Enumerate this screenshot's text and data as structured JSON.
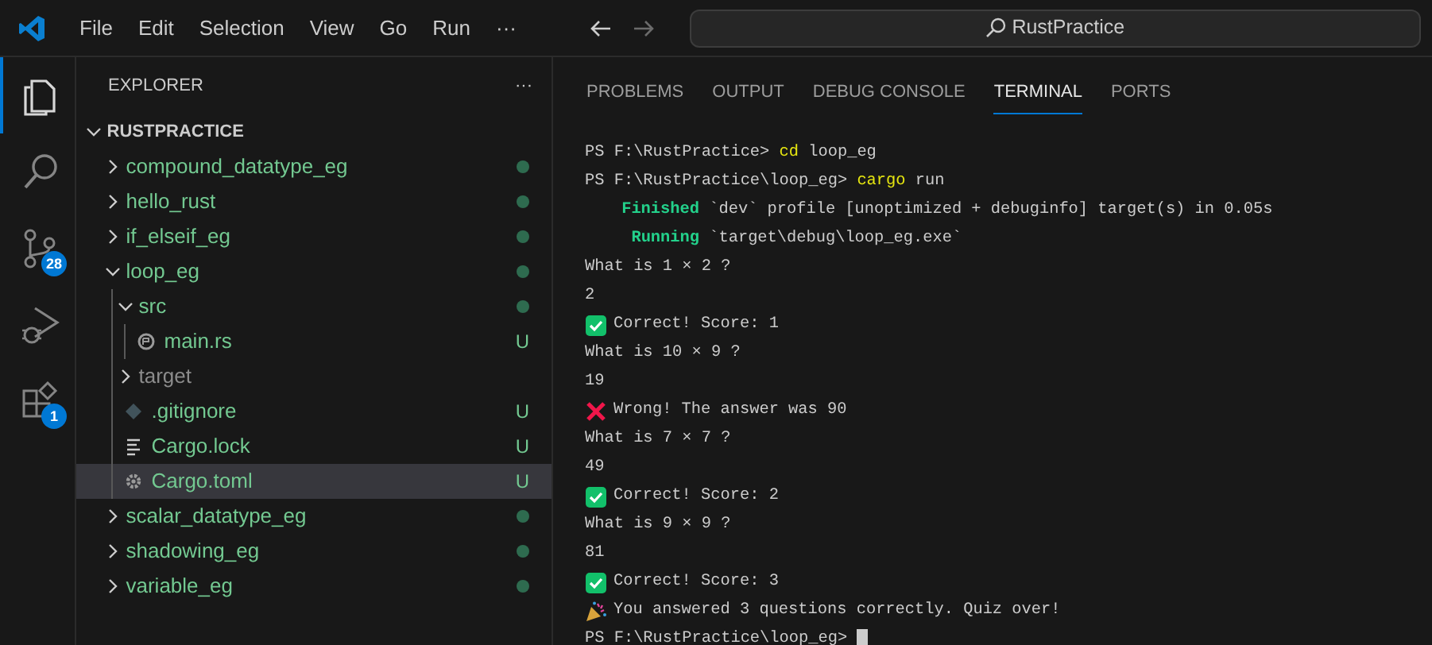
{
  "title_bar": {
    "menus": [
      "File",
      "Edit",
      "Selection",
      "View",
      "Go",
      "Run",
      "···"
    ],
    "search": {
      "value": "RustPractice"
    }
  },
  "activity_bar": [
    {
      "kind": "explorer",
      "selected": true
    },
    {
      "kind": "search",
      "selected": false
    },
    {
      "kind": "source-control",
      "selected": false,
      "badge": "28"
    },
    {
      "kind": "run-debug",
      "selected": false
    },
    {
      "kind": "extensions",
      "selected": false,
      "badge": "1"
    }
  ],
  "sidebar": {
    "title": "EXPLORER",
    "more": "···",
    "root": {
      "label": "RUSTPRACTICE",
      "expanded": true
    },
    "items": [
      {
        "label": "compound_datatype_eg",
        "kind": "folder",
        "expanded": false,
        "changed": true,
        "selected": false
      },
      {
        "label": "hello_rust",
        "kind": "folder",
        "expanded": false,
        "changed": true,
        "selected": false
      },
      {
        "label": "if_elseif_eg",
        "kind": "folder",
        "expanded": false,
        "changed": true,
        "selected": false
      },
      {
        "label": "loop_eg",
        "kind": "folder",
        "expanded": true,
        "changed": true,
        "selected": false,
        "children": [
          {
            "label": "src",
            "kind": "folder",
            "expanded": true,
            "changed": true,
            "selected": false,
            "children": [
              {
                "label": "main.rs",
                "kind": "rust",
                "decoration": "U",
                "selected": false
              }
            ]
          },
          {
            "label": "target",
            "kind": "folder",
            "expanded": false,
            "changed": false,
            "ignored": true,
            "selected": false
          },
          {
            "label": ".gitignore",
            "kind": "git",
            "decoration": "U",
            "selected": false
          },
          {
            "label": "Cargo.lock",
            "kind": "lines",
            "decoration": "U",
            "selected": false
          },
          {
            "label": "Cargo.toml",
            "kind": "gear",
            "decoration": "U",
            "selected": true
          }
        ]
      },
      {
        "label": "scalar_datatype_eg",
        "kind": "folder",
        "expanded": false,
        "changed": true,
        "selected": false
      },
      {
        "label": "shadowing_eg",
        "kind": "folder",
        "expanded": false,
        "changed": true,
        "selected": false
      },
      {
        "label": "variable_eg",
        "kind": "folder",
        "expanded": false,
        "changed": true,
        "selected": false
      }
    ]
  },
  "panel": {
    "tabs": [
      {
        "label": "PROBLEMS",
        "selected": false
      },
      {
        "label": "OUTPUT",
        "selected": false
      },
      {
        "label": "DEBUG CONSOLE",
        "selected": false
      },
      {
        "label": "TERMINAL",
        "selected": true
      },
      {
        "label": "PORTS",
        "selected": false
      }
    ],
    "terminal": [
      {
        "kind": "prompt",
        "prompt": "PS F:\\RustPractice>",
        "command": "cd",
        "args": "loop_eg"
      },
      {
        "kind": "prompt",
        "prompt": "PS F:\\RustPractice\\loop_eg>",
        "command": "cargo",
        "args": "run"
      },
      {
        "kind": "status",
        "keyword": "Finished",
        "text": "`dev` profile [unoptimized + debuginfo] target(s) in 0.05s"
      },
      {
        "kind": "status",
        "keyword": "Running",
        "text": "`target\\debug\\loop_eg.exe`"
      },
      {
        "kind": "plain",
        "text": "What is 1 × 2 ?"
      },
      {
        "kind": "plain",
        "text": "2"
      },
      {
        "kind": "correct",
        "text": "Correct! Score: 1"
      },
      {
        "kind": "plain",
        "text": "What is 10 × 9 ?"
      },
      {
        "kind": "plain",
        "text": "19"
      },
      {
        "kind": "wrong",
        "text": "Wrong! The answer was 90"
      },
      {
        "kind": "plain",
        "text": "What is 7 × 7 ?"
      },
      {
        "kind": "plain",
        "text": "49"
      },
      {
        "kind": "correct",
        "text": "Correct! Score: 2"
      },
      {
        "kind": "plain",
        "text": "What is 9 × 9 ?"
      },
      {
        "kind": "plain",
        "text": "81"
      },
      {
        "kind": "correct",
        "text": "Correct! Score: 3"
      },
      {
        "kind": "celebration",
        "text": "You answered 3 questions correctly. Quiz over!"
      },
      {
        "kind": "prompt",
        "prompt": "PS F:\\RustPractice\\loop_eg>",
        "cursor": true
      }
    ]
  }
}
